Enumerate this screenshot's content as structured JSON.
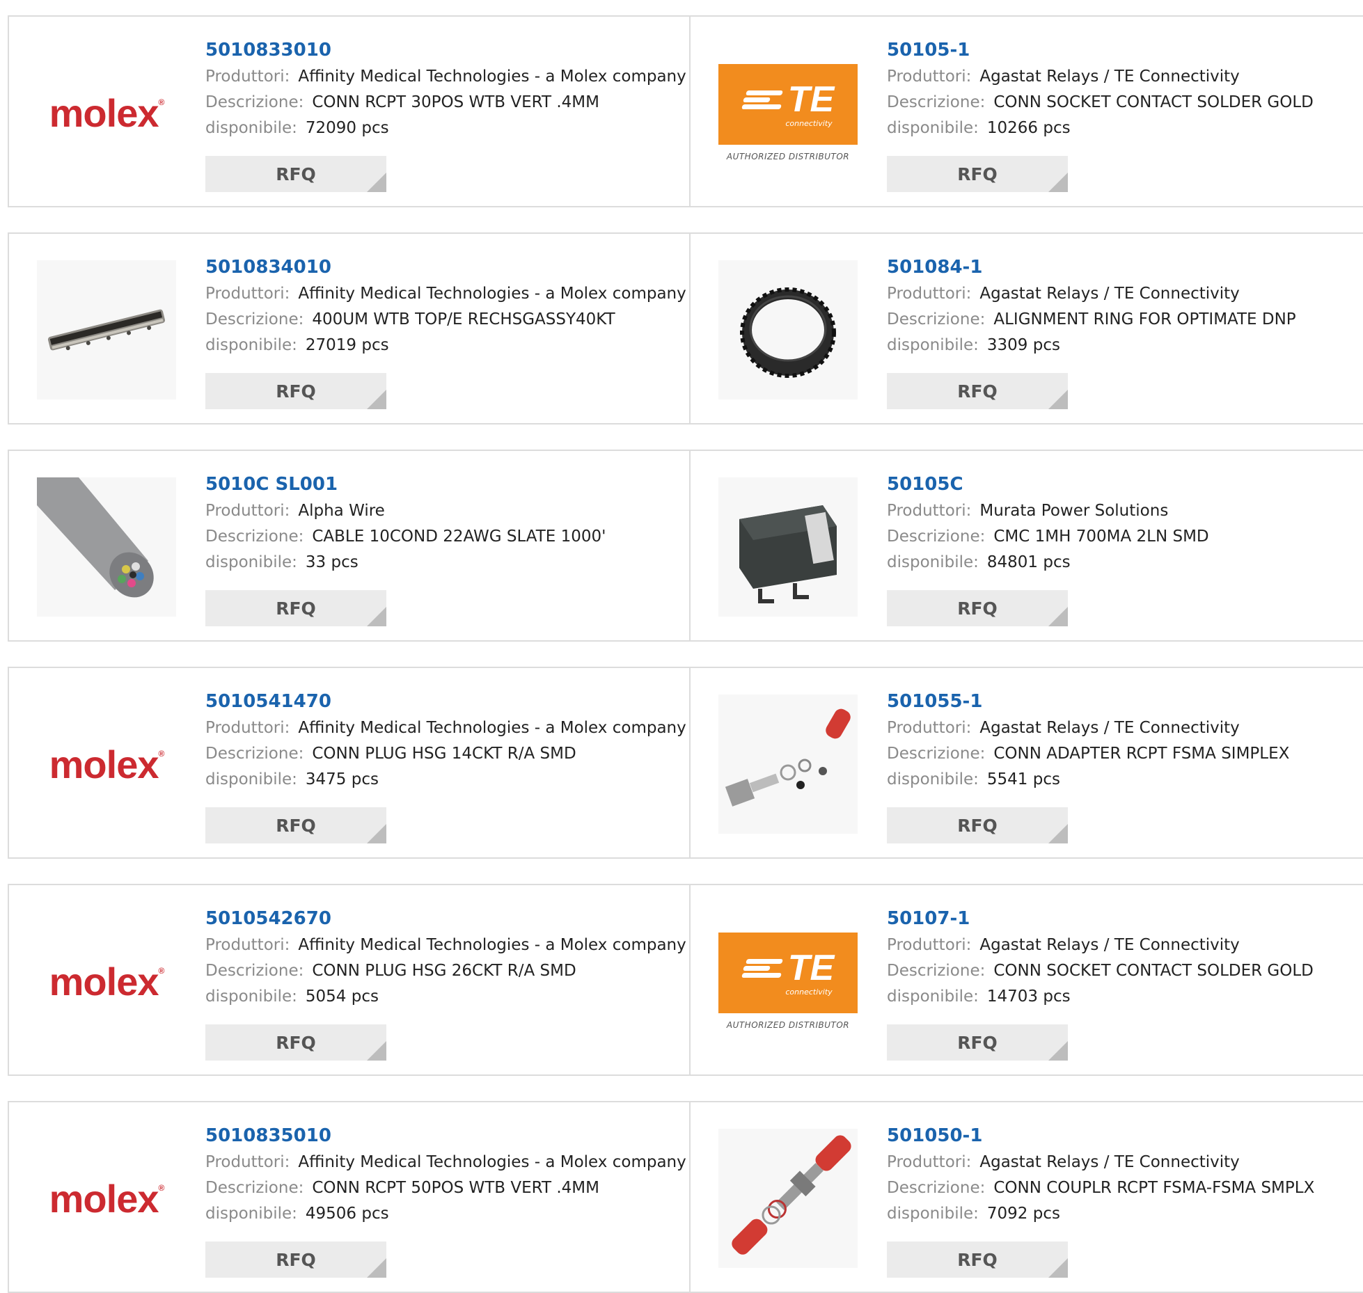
{
  "labels": {
    "manufacturer": "Produttori:",
    "description": "Descrizione:",
    "available": "disponibile:",
    "rfq": "RFQ"
  },
  "logos": {
    "molex_text": "molex",
    "molex_reg": "®",
    "te_mark": "TE",
    "te_sub": "connectivity",
    "te_authorized": "AUTHORIZED DISTRIBUTOR"
  },
  "colors": {
    "part_link": "#1a63ad",
    "molex_red": "#cc2a30",
    "te_orange": "#f28c1e",
    "rfq_bg": "#ebebeb"
  },
  "products": [
    {
      "part": "5010833010",
      "manufacturer": "Affinity Medical Technologies - a Molex company",
      "description": "CONN RCPT 30POS WTB VERT .4MM",
      "available": "72090 pcs",
      "image": "molex-logo"
    },
    {
      "part": "50105-1",
      "manufacturer": "Agastat Relays / TE Connectivity",
      "description": "CONN SOCKET CONTACT SOLDER GOLD",
      "available": "10266 pcs",
      "image": "te-logo"
    },
    {
      "part": "5010834010",
      "manufacturer": "Affinity Medical Technologies - a Molex company",
      "description": "400UM WTB TOP/E RECHSGASSY40KT",
      "available": "27019 pcs",
      "image": "connector-strip-photo"
    },
    {
      "part": "501084-1",
      "manufacturer": "Agastat Relays / TE Connectivity",
      "description": "ALIGNMENT RING FOR OPTIMATE DNP",
      "available": "3309 pcs",
      "image": "ring-photo"
    },
    {
      "part": "5010C SL001",
      "manufacturer": "Alpha Wire",
      "description": "CABLE 10COND 22AWG SLATE 1000'",
      "available": "33 pcs",
      "image": "cable-photo"
    },
    {
      "part": "50105C",
      "manufacturer": "Murata Power Solutions",
      "description": "CMC 1MH 700MA 2LN SMD",
      "available": "84801 pcs",
      "image": "inductor-photo"
    },
    {
      "part": "5010541470",
      "manufacturer": "Affinity Medical Technologies - a Molex company",
      "description": "CONN PLUG HSG 14CKT R/A SMD",
      "available": "3475 pcs",
      "image": "molex-logo"
    },
    {
      "part": "501055-1",
      "manufacturer": "Agastat Relays / TE Connectivity",
      "description": "CONN ADAPTER RCPT FSMA SIMPLEX",
      "available": "5541 pcs",
      "image": "adapter-photo"
    },
    {
      "part": "5010542670",
      "manufacturer": "Affinity Medical Technologies - a Molex company",
      "description": "CONN PLUG HSG 26CKT R/A SMD",
      "available": "5054 pcs",
      "image": "molex-logo"
    },
    {
      "part": "50107-1",
      "manufacturer": "Agastat Relays / TE Connectivity",
      "description": "CONN SOCKET CONTACT SOLDER GOLD",
      "available": "14703 pcs",
      "image": "te-logo"
    },
    {
      "part": "5010835010",
      "manufacturer": "Affinity Medical Technologies - a Molex company",
      "description": "CONN RCPT 50POS WTB VERT .4MM",
      "available": "49506 pcs",
      "image": "molex-logo"
    },
    {
      "part": "501050-1",
      "manufacturer": "Agastat Relays / TE Connectivity",
      "description": "CONN COUPLR RCPT FSMA-FSMA SMPLX",
      "available": "7092 pcs",
      "image": "coupler-photo"
    }
  ]
}
